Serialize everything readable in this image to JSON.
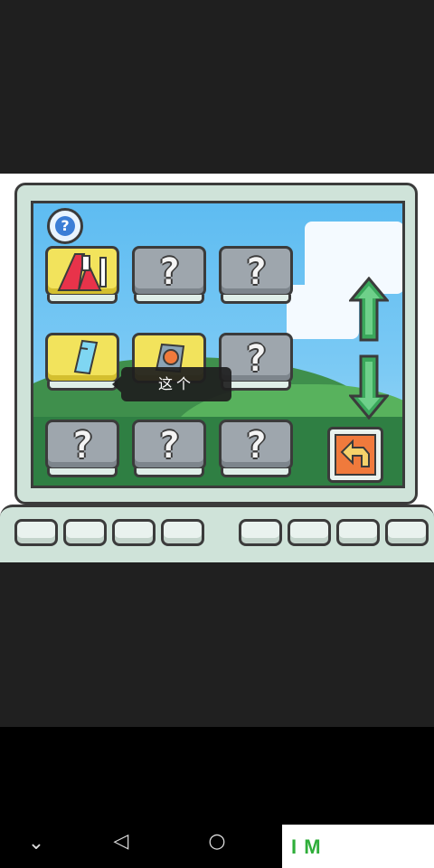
{
  "game": {
    "help_icon": "question-mark-icon",
    "help_label": "?",
    "tooltip_text": "这个",
    "locked_label": "?",
    "tiles": [
      {
        "row": 1,
        "col": 1,
        "state": "unlocked",
        "item": "red-figure"
      },
      {
        "row": 1,
        "col": 2,
        "state": "locked"
      },
      {
        "row": 1,
        "col": 3,
        "state": "locked"
      },
      {
        "row": 2,
        "col": 1,
        "state": "unlocked",
        "item": "blue-phone"
      },
      {
        "row": 2,
        "col": 2,
        "state": "unlocked",
        "item": "orange-bag"
      },
      {
        "row": 2,
        "col": 3,
        "state": "locked"
      },
      {
        "row": 3,
        "col": 1,
        "state": "locked"
      },
      {
        "row": 3,
        "col": 2,
        "state": "locked"
      },
      {
        "row": 3,
        "col": 3,
        "state": "locked"
      }
    ],
    "scroll_up_icon": "arrow-up-icon",
    "scroll_down_icon": "arrow-down-icon",
    "back_icon": "undo-arrow-icon",
    "colors": {
      "screen_bezel": "#cfe3d9",
      "outline": "#3b3b3b",
      "tile_locked": "#9ea6ad",
      "tile_unlocked": "#f2e35c",
      "arrow_green": "#3aa85b",
      "back_orange": "#f07a3c"
    }
  },
  "navbar": {
    "down_icon": "chevron-down-icon",
    "back_icon": "triangle-back-icon",
    "home_icon": "circle-home-icon"
  },
  "watermark": {
    "text": "I  M"
  }
}
